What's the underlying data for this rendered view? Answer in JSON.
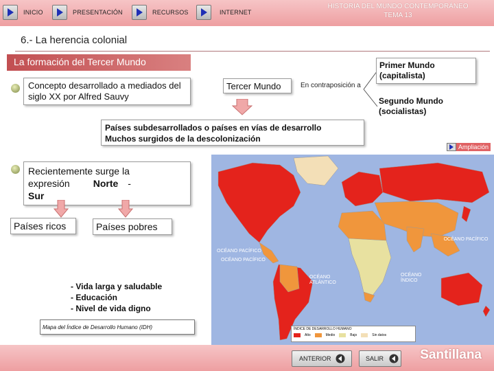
{
  "nav": {
    "inicio": "INICIO",
    "presentacion": "PRESENTACIÓN",
    "recursos": "RECURSOS",
    "internet": "INTERNET"
  },
  "course": {
    "line1": "HISTORIA DEL MUNDO CONTEMPORÁNEO",
    "line2": "TEMA 13"
  },
  "section_title": "6.- La herencia colonial",
  "banner": "La formación del Tercer Mundo",
  "concept_text": "Concepto desarrollado a mediados del siglo XX por Alfred Sauvy",
  "tercer_mundo": "Tercer Mundo",
  "en_contraposicion": "En contraposición a",
  "primer_mundo": "Primer Mundo (capitalista)",
  "segundo_mundo": "Segundo Mundo (socialistas)",
  "paises_sub": {
    "line1": "Países subdesarrollados o países en vías de desarrollo",
    "line2": "Muchos surgidos de la descolonización"
  },
  "ampliacion": "Ampliación",
  "norte_sur": {
    "line1": "Recientemente surge la",
    "line2a": "expresión",
    "line2b": "Norte",
    "line2c": "-",
    "line3": "Sur"
  },
  "paises_ricos": "Países ricos",
  "paises_pobres": "Países pobres",
  "criteria": [
    "- Vida larga y saludable",
    "- Educación",
    "- Nivel de vida digno"
  ],
  "map_caption": "Mapa del Índice de Desarrollo Humano (IDH)",
  "map_labels": {
    "oceano_pacifico_left": "OCÉANO PACÍFICO",
    "oceano_pacifico_left2": "OCÉANO PACÍFICO",
    "oceano_pacifico_right": "OCÉANO PACÍFICO",
    "oceano_atlantico": "OCÉANO ATLÁNTICO",
    "oceano_indico": "OCÉANO ÍNDICO",
    "legend_title": "ÍNDICE DE DESARROLLO HUMANO",
    "legend_items": [
      "Alto",
      "Medio",
      "Bajo",
      "Sin datos"
    ]
  },
  "colors": {
    "alto": "#e8e1a0",
    "medio": "#f0963c",
    "bajo": "#e4231c",
    "sin_datos": "#f3dfb7",
    "ocean": "#9fb6e2",
    "accent": "#c24f52"
  },
  "bottom": {
    "anterior": "ANTERIOR",
    "salir": "SALIR",
    "brand": "Santillana"
  }
}
